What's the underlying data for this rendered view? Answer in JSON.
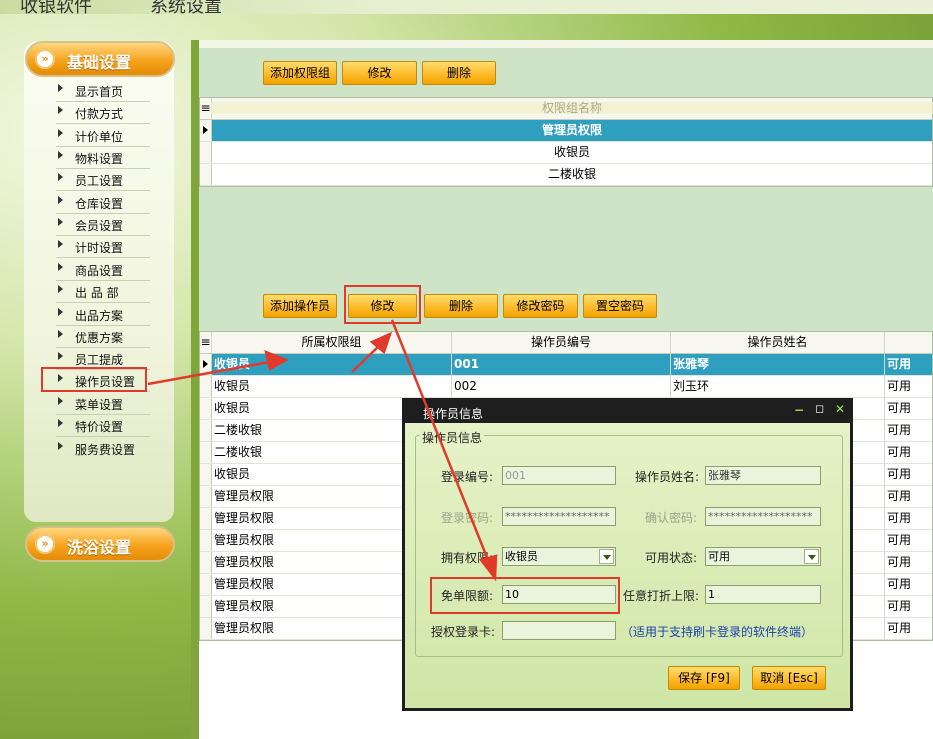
{
  "app": {
    "title_left": "收银软件",
    "title_right": "系统设置"
  },
  "nav": {
    "section1": "基础设置",
    "items": [
      "显示首页",
      "付款方式",
      "计价单位",
      "物料设置",
      "员工设置",
      "仓库设置",
      "会员设置",
      "计时设置",
      "商品设置",
      "出 品 部",
      "出品方案",
      "优惠方案",
      "员工提成",
      "操作员设置",
      "菜单设置",
      "特价设置",
      "服务费设置"
    ],
    "section2": "洗浴设置"
  },
  "groups": {
    "buttons": [
      "添加权限组",
      "修改",
      "删除"
    ],
    "header": "权限组名称",
    "rows": [
      "管理员权限",
      "收银员",
      "二楼收银"
    ]
  },
  "operators": {
    "buttons": [
      "添加操作员",
      "修改",
      "删除",
      "修改密码",
      "置空密码"
    ],
    "headers": [
      "所属权限组",
      "操作员编号",
      "操作员姓名",
      ""
    ],
    "rows": [
      [
        "收银员",
        "001",
        "张雅琴",
        "可用"
      ],
      [
        "收银员",
        "002",
        "刘玉环",
        "可用"
      ],
      [
        "收银员",
        "",
        "",
        "可用"
      ],
      [
        "二楼收银",
        "",
        "",
        "可用"
      ],
      [
        "二楼收银",
        "",
        "",
        "可用"
      ],
      [
        "收银员",
        "",
        "",
        "可用"
      ],
      [
        "管理员权限",
        "",
        "",
        "可用"
      ],
      [
        "管理员权限",
        "",
        "",
        "可用"
      ],
      [
        "管理员权限",
        "",
        "",
        "可用"
      ],
      [
        "管理员权限",
        "",
        "",
        "可用"
      ],
      [
        "管理员权限",
        "",
        "",
        "可用"
      ],
      [
        "管理员权限",
        "",
        "",
        "可用"
      ],
      [
        "管理员权限",
        "",
        "",
        "可用"
      ]
    ]
  },
  "dialog": {
    "title": "操作员信息",
    "group": "操作员信息",
    "login_no_label": "登录编号:",
    "login_no": "001",
    "name_label": "操作员姓名:",
    "name": "张雅琴",
    "pwd_label": "登录密码:",
    "pwd": "*******************",
    "confirm_label": "确认密码:",
    "confirm": "*******************",
    "role_label": "拥有权限:",
    "role": "收银员",
    "status_label": "可用状态:",
    "status": "可用",
    "free_label": "免单限额:",
    "free": "10",
    "discount_label": "任意打折上限:",
    "discount": "1",
    "card_label": "授权登录卡:",
    "card": "",
    "card_hint": "（适用于支持刷卡登录的软件终端）",
    "save": "保存 [F9]",
    "cancel": "取消 [Esc]"
  },
  "colors": {
    "accent": "#f6a31e",
    "selected_row": "#2e9fbf",
    "annotation": "#e23a2a"
  }
}
